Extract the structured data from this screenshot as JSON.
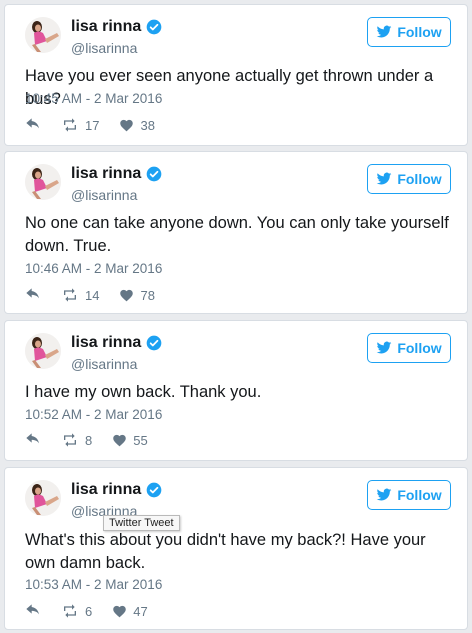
{
  "tweets": [
    {
      "name": "lisa rinna",
      "handle": "@lisarinna",
      "follow_label": "Follow",
      "text": "Have you ever seen anyone actually get thrown under a bus?",
      "timestamp": "10:45 AM - 2 Mar 2016",
      "retweets": "17",
      "likes": "38"
    },
    {
      "name": "lisa rinna",
      "handle": "@lisarinna",
      "follow_label": "Follow",
      "text": "No one can take anyone down. You can only take yourself down. True.",
      "timestamp": "10:46 AM - 2 Mar 2016",
      "retweets": "14",
      "likes": "78"
    },
    {
      "name": "lisa rinna",
      "handle": "@lisarinna",
      "follow_label": "Follow",
      "text": "I have my own back. Thank you.",
      "timestamp": "10:52 AM - 2 Mar 2016",
      "retweets": "8",
      "likes": "55"
    },
    {
      "name": "lisa rinna",
      "handle": "@lisarinna",
      "follow_label": "Follow",
      "text": "What's this about you didn't have my back?! Have your own damn back.",
      "timestamp": "10:53 AM - 2 Mar 2016",
      "retweets": "6",
      "likes": "47"
    }
  ],
  "tooltip": "Twitter Tweet",
  "icons": {
    "verified": "verified-badge-icon",
    "follow": "twitter-bird-icon",
    "reply": "reply-icon",
    "retweet": "retweet-icon",
    "like": "heart-icon"
  },
  "colors": {
    "accent": "#1da1f2",
    "muted": "#657786",
    "text": "#14171a"
  }
}
